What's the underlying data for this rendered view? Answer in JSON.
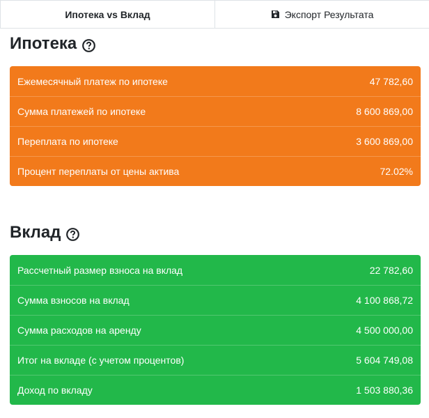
{
  "tabs": {
    "compare_label": "Ипотека vs Вклад",
    "compare_vs": "vs",
    "export_label": "Экспорт Результата",
    "export_icon": "save-icon"
  },
  "mortgage": {
    "title": "Ипотека",
    "help_icon": "question-circle-icon",
    "color": "#f27a1b",
    "rows": [
      {
        "label": "Ежемесячный платеж по ипотеке",
        "value": "47 782,60"
      },
      {
        "label": "Сумма платежей по ипотеке",
        "value": "8 600 869,00"
      },
      {
        "label": "Переплата по ипотеке",
        "value": "3 600 869,00"
      },
      {
        "label": "Процент переплаты от цены актива",
        "value": "72.02%"
      }
    ]
  },
  "deposit": {
    "title": "Вклад",
    "help_icon": "question-circle-icon",
    "color": "#22b84a",
    "rows": [
      {
        "label": "Рассчетный размер взноса на вклад",
        "value": "22 782,60"
      },
      {
        "label": "Сумма взносов на вклад",
        "value": "4 100 868,72"
      },
      {
        "label": "Сумма расходов на аренду",
        "value": "4 500 000,00"
      },
      {
        "label": "Итог на вкладе (с учетом процентов)",
        "value": "5 604 749,08"
      },
      {
        "label": "Доход по вкладу",
        "value": "1 503 880,36"
      }
    ]
  }
}
